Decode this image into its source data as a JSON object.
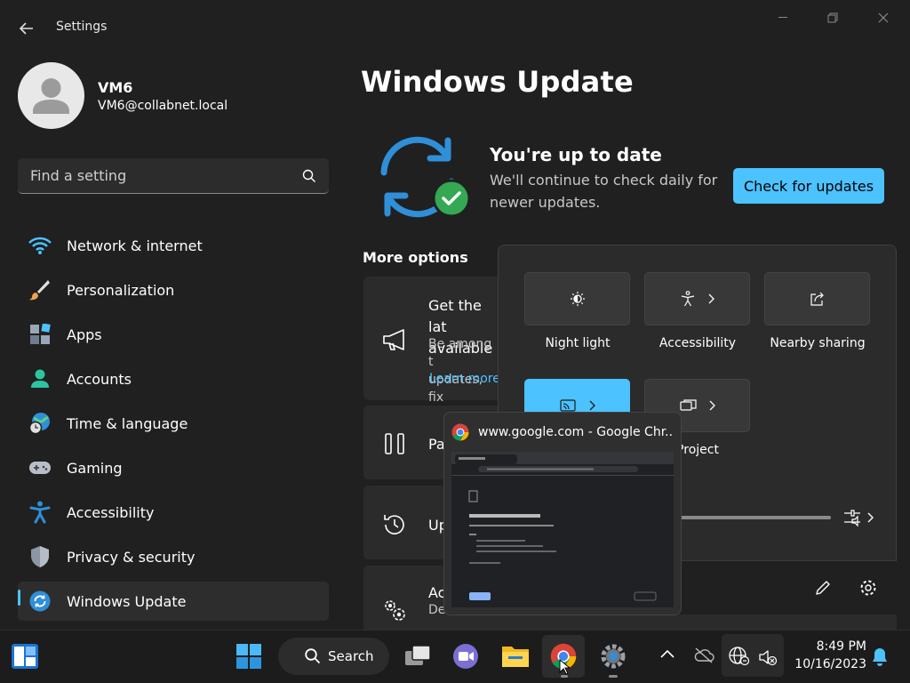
{
  "window": {
    "title": "Settings"
  },
  "profile": {
    "name": "VM6",
    "email": "VM6@collabnet.local"
  },
  "search": {
    "placeholder": "Find a setting"
  },
  "sidebar": {
    "items": [
      {
        "label": "Network & internet",
        "icon": "wifi-icon"
      },
      {
        "label": "Personalization",
        "icon": "brush-icon"
      },
      {
        "label": "Apps",
        "icon": "apps-icon"
      },
      {
        "label": "Accounts",
        "icon": "person-icon"
      },
      {
        "label": "Time & language",
        "icon": "globe-clock-icon"
      },
      {
        "label": "Gaming",
        "icon": "gamepad-icon"
      },
      {
        "label": "Accessibility",
        "icon": "accessibility-icon"
      },
      {
        "label": "Privacy & security",
        "icon": "shield-icon"
      },
      {
        "label": "Windows Update",
        "icon": "update-icon",
        "selected": true
      }
    ]
  },
  "main": {
    "title": "Windows Update",
    "status_title": "You're up to date",
    "status_subtitle": "We'll continue to check daily for newer updates.",
    "check_button": "Check for updates",
    "more_options": "More options",
    "cards": [
      {
        "title": "Get the lat",
        "title2": "available",
        "desc": "Be among t",
        "desc2": "updates, fix",
        "link": "Learn more"
      },
      {
        "title": "Pa"
      },
      {
        "title": "Up"
      },
      {
        "title": "Ac",
        "desc": "De"
      }
    ]
  },
  "quick_settings": {
    "tiles": [
      {
        "label": "Night light",
        "icon": "night-light-icon"
      },
      {
        "label": "Accessibility",
        "icon": "accessibility-icon"
      },
      {
        "label": "Nearby sharing",
        "icon": "share-icon"
      },
      {
        "label": "",
        "icon": "cast-icon",
        "active": true
      },
      {
        "label": "Project",
        "icon": "project-icon"
      }
    ]
  },
  "chrome_preview": {
    "title": "www.google.com - Google Chr..."
  },
  "taskbar": {
    "search_label": "Search",
    "time": "8:49 PM",
    "date": "10/16/2023"
  },
  "colors": {
    "accent": "#4cc2ff",
    "background": "#202020",
    "card": "#2b2b2b"
  }
}
